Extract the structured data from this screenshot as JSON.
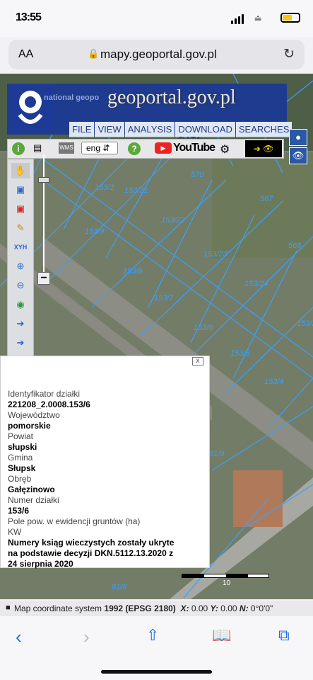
{
  "status_bar": {
    "time": "13:55",
    "battery_color": "#f5c518"
  },
  "url_bar": {
    "aa_label": "AA",
    "url": "mapy.geoportal.gov.pl"
  },
  "header": {
    "national_label": "national geopo",
    "site_title": "geoportal.gov.pl",
    "brand_color": "#1f3b8f"
  },
  "menu": [
    "FILE",
    "VIEW",
    "ANALYSIS",
    "DOWNLOAD DATA",
    "SEARCHES"
  ],
  "toolbar": {
    "language": "eng",
    "youtube_label": "YouTube"
  },
  "parcel_labels": [
    "570",
    "153/2",
    "153/21",
    "567",
    "153/22",
    "153/9",
    "566",
    "153/23",
    "153/8",
    "153/24",
    "153/7",
    "153/6",
    "153/2",
    "153/5",
    "153/4",
    "81/9",
    "81/6"
  ],
  "popup": {
    "close_label": "x",
    "fields": [
      {
        "label": "Identyfikator działki",
        "value": "221208_2.0008.153/6"
      },
      {
        "label": "Województwo",
        "value": "pomorskie"
      },
      {
        "label": "Powiat",
        "value": "słupski"
      },
      {
        "label": "Gmina",
        "value": "Słupsk"
      },
      {
        "label": "Obręb",
        "value": "Gałęzinowo"
      },
      {
        "label": "Numer działki",
        "value": "153/6"
      },
      {
        "label": "Pole pow. w ewidencji gruntów (ha)",
        "value": ""
      },
      {
        "label": "KW",
        "value": "Numery ksiąg wieczystych zostały ukryte na podstawie decyzji DKN.5112.13.2020 z 24 sierpnia 2020"
      }
    ]
  },
  "scale": {
    "label": "10"
  },
  "coords": {
    "prefix": "Map coordinate system ",
    "system": "1992 (EPSG 2180)",
    "x_label": "X:",
    "x_value": "0.00",
    "y_label": "Y:",
    "y_value": "0.00",
    "n_label": "N:",
    "n_value": "0°0'0\""
  }
}
